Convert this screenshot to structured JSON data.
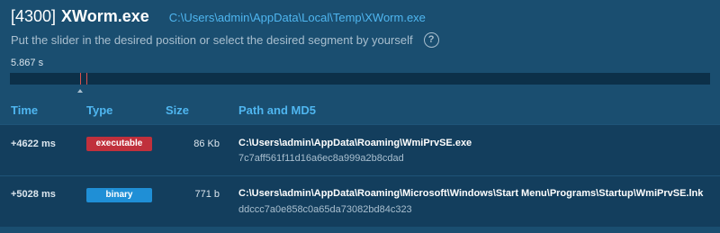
{
  "header": {
    "pid": "[4300]",
    "process_name": "XWorm.exe",
    "process_path": "C:\\Users\\admin\\AppData\\Local\\Temp\\XWorm.exe"
  },
  "hint": {
    "text": "Put the slider in the desired position or select the desired segment by yourself",
    "help_glyph": "?"
  },
  "timeline": {
    "duration_label": "5.867 s",
    "marker_color": "#d9534f"
  },
  "table": {
    "columns": [
      "Time",
      "Type",
      "Size",
      "Path and MD5"
    ],
    "rows": [
      {
        "time": "+4622 ms",
        "type": "executable",
        "type_color": "#c0303c",
        "size": "86 Kb",
        "path": "C:\\Users\\admin\\AppData\\Roaming\\WmiPrvSE.exe",
        "md5": "7c7aff561f11d16a6ec8a999a2b8cdad"
      },
      {
        "time": "+5028 ms",
        "type": "binary",
        "type_color": "#1f8fd6",
        "size": "771 b",
        "path": "C:\\Users\\admin\\AppData\\Roaming\\Microsoft\\Windows\\Start Menu\\Programs\\Startup\\WmiPrvSE.lnk",
        "md5": "ddccc7a0e858c0a65da73082bd84c323"
      }
    ]
  }
}
